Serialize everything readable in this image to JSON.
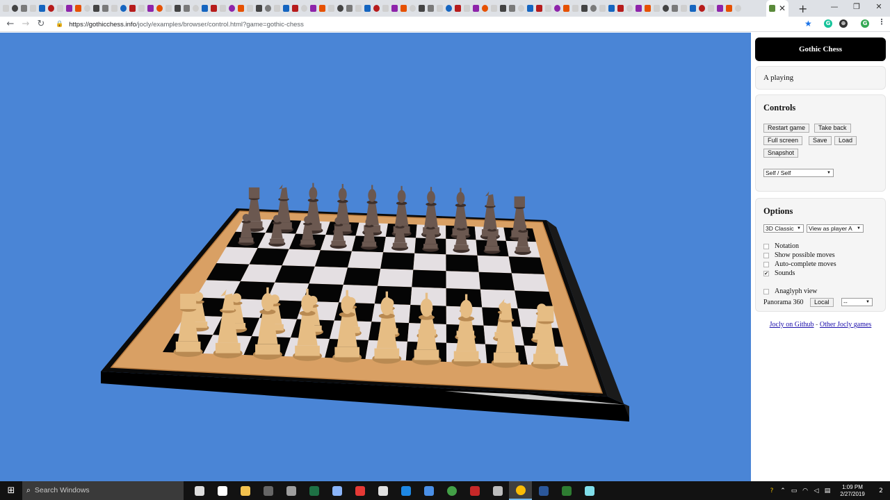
{
  "browser": {
    "url_host": "https://gothicchess.info",
    "url_path": "/jocly/examples/browser/control.html?game=gothic-chess",
    "tab_close": "✕",
    "new_tab": "+",
    "win_min": "—",
    "win_max": "❐",
    "win_close": "✕",
    "back": "←",
    "forward": "→",
    "reload": "↻",
    "lock": "🔒",
    "star": "★"
  },
  "panel": {
    "title": "Gothic Chess",
    "status": "A playing",
    "controls": {
      "heading": "Controls",
      "restart": "Restart game",
      "take_back": "Take back",
      "full_screen": "Full screen",
      "save": "Save",
      "load": "Load",
      "snapshot": "Snapshot",
      "mode_select": "Self / Self"
    },
    "options": {
      "heading": "Options",
      "skin_select": "3D Classic",
      "view_select": "View as player A",
      "notation": "Notation",
      "show_moves": "Show possible moves",
      "autocomplete": "Auto-complete moves",
      "sounds": "Sounds",
      "sounds_checked": "✔",
      "anaglyph": "Anaglyph view",
      "panorama_label": "Panorama 360",
      "local_button": "Local",
      "panorama_select": "--"
    },
    "links": {
      "github": "Jocly on Github",
      "separator": " - ",
      "other": "Other Jocly games"
    }
  },
  "taskbar": {
    "start": "⊞",
    "search_placeholder": "Search Windows",
    "time": "1:09 PM",
    "date": "2/27/2019",
    "notifications": "2"
  },
  "board": {
    "cols": 10,
    "rows": 8,
    "light_square": "#e4dfe2",
    "dark_square": "#050505",
    "wood": "#d9a064",
    "white_piece": "#e6bd84",
    "black_piece": "#6b5850"
  },
  "icons": {
    "tab_favicon": "page-icon",
    "extension_icons": [
      "grammarly-icon",
      "extension-icon",
      "profile-icon",
      "menu-icon"
    ]
  }
}
